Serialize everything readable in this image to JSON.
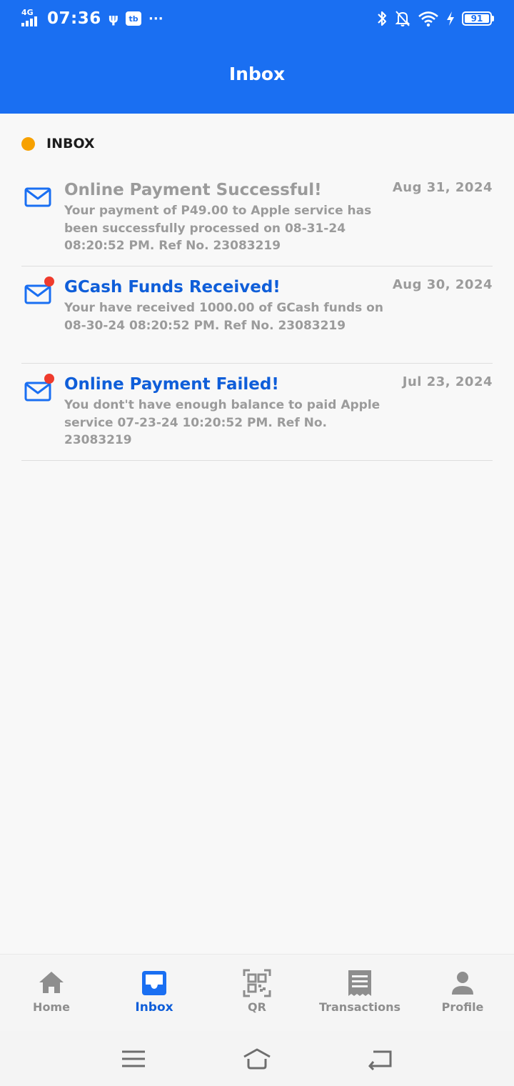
{
  "status_bar": {
    "network": "4G",
    "time": "07:36",
    "usb_glyph": "ψ",
    "app_badge": "tb",
    "more_glyph": "···",
    "battery_level": "91",
    "icons": [
      "usb-icon",
      "bluetooth-icon",
      "mute-icon",
      "wifi-icon",
      "charging-icon",
      "battery-icon"
    ]
  },
  "header": {
    "title": "Inbox"
  },
  "section": {
    "label": "INBOX",
    "dot_color": "#f7a100"
  },
  "messages": [
    {
      "title": "Online Payment Successful!",
      "date": "Aug 31, 2024",
      "body": "Your payment of P49.00 to Apple service has been successfully processed on 08-31-24 08:20:52 PM. Ref No. 23083219",
      "unread": false
    },
    {
      "title": "GCash Funds Received!",
      "date": "Aug 30, 2024",
      "body": "Your have received 1000.00 of GCash funds on 08-30-24 08:20:52 PM. Ref No. 23083219",
      "unread": true
    },
    {
      "title": "Online Payment Failed!",
      "date": "Jul 23, 2024",
      "body": "You dont't have enough balance to paid Apple service 07-23-24 10:20:52 PM. Ref No. 23083219",
      "unread": true
    }
  ],
  "bottom_nav": {
    "items": [
      {
        "label": "Home",
        "icon": "home-icon",
        "active": false
      },
      {
        "label": "Inbox",
        "icon": "inbox-icon",
        "active": true
      },
      {
        "label": "QR",
        "icon": "qr-icon",
        "active": false
      },
      {
        "label": "Transactions",
        "icon": "receipt-icon",
        "active": false
      },
      {
        "label": "Profile",
        "icon": "person-icon",
        "active": false
      }
    ]
  },
  "colors": {
    "primary": "#1a6ff2",
    "unread_title": "#0f5ed9",
    "muted": "#9b9b9b",
    "unread_dot": "#ef3b2d"
  }
}
